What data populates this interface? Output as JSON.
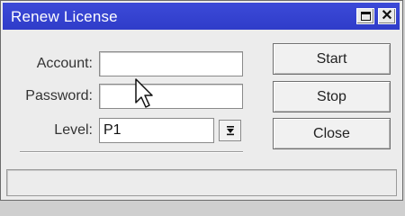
{
  "window": {
    "title": "Renew License",
    "maximize_icon": "maximize-icon",
    "close_icon": "close-icon"
  },
  "form": {
    "account_label": "Account:",
    "account_value": "",
    "password_label": "Password:",
    "password_value": "",
    "level_label": "Level:",
    "level_value": "P1",
    "level_dropdown_icon": "dropdown-arrow-icon"
  },
  "buttons": {
    "start": "Start",
    "stop": "Stop",
    "close": "Close"
  },
  "status": {
    "text": ""
  },
  "colors": {
    "titlebar": "#3541d2",
    "window_bg": "#ececec"
  }
}
